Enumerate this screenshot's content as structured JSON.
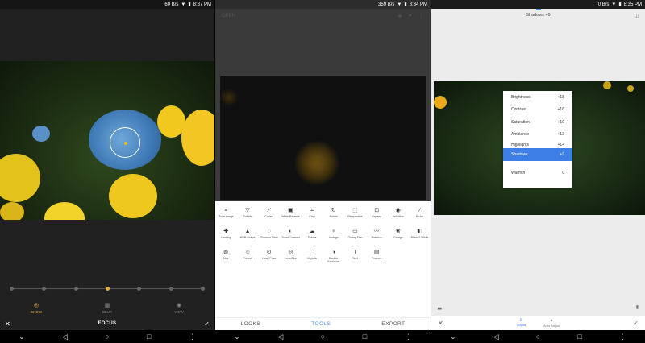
{
  "panel1": {
    "status": {
      "speed": "60 B/s",
      "time": "8:37 PM"
    },
    "modes": [
      {
        "label": "SHOW",
        "icon": "shape-icon",
        "active": true
      },
      {
        "label": "BLUR",
        "icon": "grid-icon",
        "active": false
      },
      {
        "label": "VIEW",
        "icon": "vignette-icon",
        "active": false
      }
    ],
    "title": "FOCUS",
    "slider_active_index": 3,
    "slider_dots": 7
  },
  "panel2": {
    "status": {
      "speed": "359 B/s",
      "time": "8:34 PM"
    },
    "top_label": "OPEN",
    "tools": [
      {
        "label": "Tune Image",
        "icon": "≡"
      },
      {
        "label": "Details",
        "icon": "▽"
      },
      {
        "label": "Curves",
        "icon": "⟋"
      },
      {
        "label": "White Balance",
        "icon": "▣"
      },
      {
        "label": "Crop",
        "icon": "⌗"
      },
      {
        "label": "Rotate",
        "icon": "↻"
      },
      {
        "label": "Perspective",
        "icon": "⬚"
      },
      {
        "label": "Expand",
        "icon": "⊡"
      },
      {
        "label": "Selective",
        "icon": "◉"
      },
      {
        "label": "Brush",
        "icon": "∕"
      },
      {
        "label": "Healing",
        "icon": "✚"
      },
      {
        "label": "HDR Scape",
        "icon": "▲"
      },
      {
        "label": "Glamour Glow",
        "icon": "◌"
      },
      {
        "label": "Tonal Contrast",
        "icon": "◐"
      },
      {
        "label": "Drama",
        "icon": "☁"
      },
      {
        "label": "Vintage",
        "icon": "♀"
      },
      {
        "label": "Grainy Film",
        "icon": "▭"
      },
      {
        "label": "Retrolux",
        "icon": "〰"
      },
      {
        "label": "Grunge",
        "icon": "❀"
      },
      {
        "label": "Black & White",
        "icon": "◧"
      },
      {
        "label": "Noir",
        "icon": "◍"
      },
      {
        "label": "Portrait",
        "icon": "☺"
      },
      {
        "label": "Head Pose",
        "icon": "⊙"
      },
      {
        "label": "Lens Blur",
        "icon": "◎"
      },
      {
        "label": "Vignette",
        "icon": "▢"
      },
      {
        "label": "Double Exposure",
        "icon": "◑"
      },
      {
        "label": "Text",
        "icon": "T"
      },
      {
        "label": "Frames",
        "icon": "▤"
      }
    ],
    "tabs": [
      {
        "label": "LOOKS",
        "active": false
      },
      {
        "label": "TOOLS",
        "active": true
      },
      {
        "label": "EXPORT",
        "active": false
      }
    ]
  },
  "panel3": {
    "status": {
      "speed": "0 B/s",
      "time": "8:35 PM"
    },
    "title": "Shadows +9",
    "menu": [
      {
        "label": "Brightness",
        "value": "+18"
      },
      {
        "label": "Contrast",
        "value": "+16"
      },
      {
        "label": "Saturation",
        "value": "+19"
      },
      {
        "label": "Ambiance",
        "value": "+13"
      },
      {
        "label": "Highlights",
        "value": "+14"
      },
      {
        "label": "Shadows",
        "value": "+9",
        "active": true
      },
      {
        "label": "Warmth",
        "value": "0"
      }
    ],
    "bottom_tabs": [
      {
        "label": "Adjust",
        "icon": "≡",
        "active": true
      },
      {
        "label": "Auto Adjust",
        "icon": "✦",
        "active": false
      }
    ]
  },
  "colors": {
    "accent_yellow": "#e6b43c",
    "accent_blue": "#3d7fe6",
    "tab_blue": "#4a8ef0"
  }
}
